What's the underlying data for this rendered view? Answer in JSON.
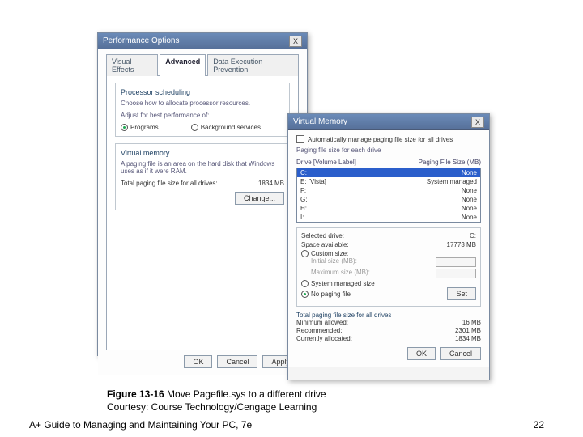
{
  "perf": {
    "title": "Performance Options",
    "close": "X",
    "tabs": {
      "visual": "Visual Effects",
      "advanced": "Advanced",
      "dep": "Data Execution Prevention"
    },
    "sched_title": "Processor scheduling",
    "sched_text": "Choose how to allocate processor resources.",
    "adjust_label": "Adjust for best performance of:",
    "programs_label": "Programs",
    "bg_label": "Background services",
    "vm_title": "Virtual memory",
    "vm_text": "A paging file is an area on the hard disk that Windows uses as if it were RAM.",
    "total_label": "Total paging file size for all drives:",
    "total_value": "1834 MB",
    "change": "Change...",
    "ok": "OK",
    "cancel": "Cancel",
    "apply": "Apply"
  },
  "vmem": {
    "title": "Virtual Memory",
    "close": "X",
    "auto": "Automatically manage paging file size for all drives",
    "each": "Paging file size for each drive",
    "col_drive": "Drive [Volume Label]",
    "col_size": "Paging File Size (MB)",
    "drives": [
      {
        "d": "C:",
        "s": "None"
      },
      {
        "d": "E:  [Vista]",
        "s": "System managed"
      },
      {
        "d": "F:",
        "s": "None"
      },
      {
        "d": "G:",
        "s": "None"
      },
      {
        "d": "H:",
        "s": "None"
      },
      {
        "d": "I:",
        "s": "None"
      }
    ],
    "sel_label": "Selected drive:",
    "sel_value": "C:",
    "space_label": "Space available:",
    "space_value": "17773 MB",
    "custom": "Custom size:",
    "initial": "Initial size (MB):",
    "max": "Maximum size (MB):",
    "sysman": "System managed size",
    "nopage": "No paging file",
    "set": "Set",
    "tot_title": "Total paging file size for all drives",
    "min_l": "Minimum allowed:",
    "min_v": "16 MB",
    "rec_l": "Recommended:",
    "rec_v": "2301 MB",
    "cur_l": "Currently allocated:",
    "cur_v": "1834 MB",
    "ok": "OK",
    "cancel": "Cancel"
  },
  "caption": {
    "fig": "Figure 13-16",
    "text": " Move Pagefile.sys to a different drive",
    "courtesy": "Courtesy: Course Technology/Cengage Learning"
  },
  "footer": "A+ Guide to Managing and Maintaining Your PC, 7e",
  "page": "22"
}
